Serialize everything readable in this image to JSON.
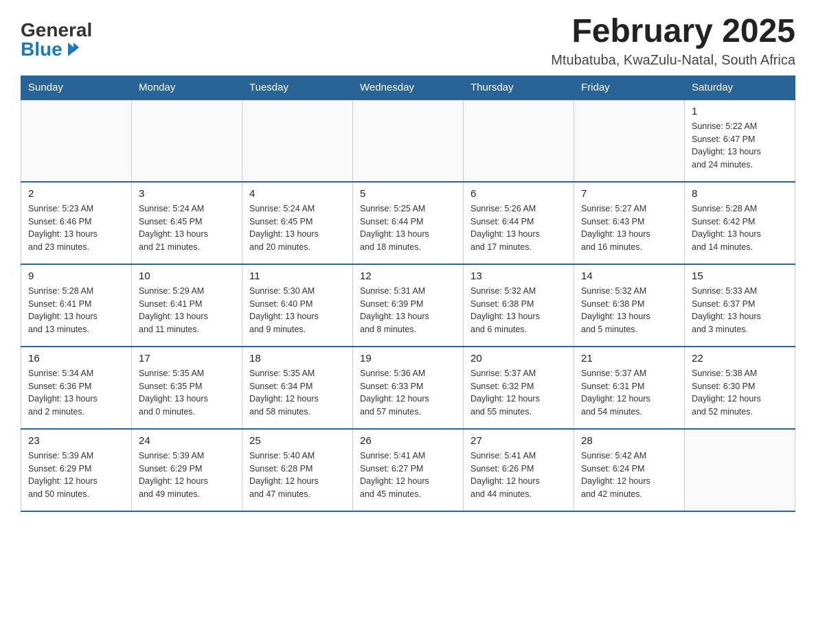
{
  "logo": {
    "general": "General",
    "blue": "Blue"
  },
  "title": "February 2025",
  "location": "Mtubatuba, KwaZulu-Natal, South Africa",
  "weekdays": [
    "Sunday",
    "Monday",
    "Tuesday",
    "Wednesday",
    "Thursday",
    "Friday",
    "Saturday"
  ],
  "weeks": [
    [
      {
        "day": "",
        "info": ""
      },
      {
        "day": "",
        "info": ""
      },
      {
        "day": "",
        "info": ""
      },
      {
        "day": "",
        "info": ""
      },
      {
        "day": "",
        "info": ""
      },
      {
        "day": "",
        "info": ""
      },
      {
        "day": "1",
        "info": "Sunrise: 5:22 AM\nSunset: 6:47 PM\nDaylight: 13 hours\nand 24 minutes."
      }
    ],
    [
      {
        "day": "2",
        "info": "Sunrise: 5:23 AM\nSunset: 6:46 PM\nDaylight: 13 hours\nand 23 minutes."
      },
      {
        "day": "3",
        "info": "Sunrise: 5:24 AM\nSunset: 6:45 PM\nDaylight: 13 hours\nand 21 minutes."
      },
      {
        "day": "4",
        "info": "Sunrise: 5:24 AM\nSunset: 6:45 PM\nDaylight: 13 hours\nand 20 minutes."
      },
      {
        "day": "5",
        "info": "Sunrise: 5:25 AM\nSunset: 6:44 PM\nDaylight: 13 hours\nand 18 minutes."
      },
      {
        "day": "6",
        "info": "Sunrise: 5:26 AM\nSunset: 6:44 PM\nDaylight: 13 hours\nand 17 minutes."
      },
      {
        "day": "7",
        "info": "Sunrise: 5:27 AM\nSunset: 6:43 PM\nDaylight: 13 hours\nand 16 minutes."
      },
      {
        "day": "8",
        "info": "Sunrise: 5:28 AM\nSunset: 6:42 PM\nDaylight: 13 hours\nand 14 minutes."
      }
    ],
    [
      {
        "day": "9",
        "info": "Sunrise: 5:28 AM\nSunset: 6:41 PM\nDaylight: 13 hours\nand 13 minutes."
      },
      {
        "day": "10",
        "info": "Sunrise: 5:29 AM\nSunset: 6:41 PM\nDaylight: 13 hours\nand 11 minutes."
      },
      {
        "day": "11",
        "info": "Sunrise: 5:30 AM\nSunset: 6:40 PM\nDaylight: 13 hours\nand 9 minutes."
      },
      {
        "day": "12",
        "info": "Sunrise: 5:31 AM\nSunset: 6:39 PM\nDaylight: 13 hours\nand 8 minutes."
      },
      {
        "day": "13",
        "info": "Sunrise: 5:32 AM\nSunset: 6:38 PM\nDaylight: 13 hours\nand 6 minutes."
      },
      {
        "day": "14",
        "info": "Sunrise: 5:32 AM\nSunset: 6:38 PM\nDaylight: 13 hours\nand 5 minutes."
      },
      {
        "day": "15",
        "info": "Sunrise: 5:33 AM\nSunset: 6:37 PM\nDaylight: 13 hours\nand 3 minutes."
      }
    ],
    [
      {
        "day": "16",
        "info": "Sunrise: 5:34 AM\nSunset: 6:36 PM\nDaylight: 13 hours\nand 2 minutes."
      },
      {
        "day": "17",
        "info": "Sunrise: 5:35 AM\nSunset: 6:35 PM\nDaylight: 13 hours\nand 0 minutes."
      },
      {
        "day": "18",
        "info": "Sunrise: 5:35 AM\nSunset: 6:34 PM\nDaylight: 12 hours\nand 58 minutes."
      },
      {
        "day": "19",
        "info": "Sunrise: 5:36 AM\nSunset: 6:33 PM\nDaylight: 12 hours\nand 57 minutes."
      },
      {
        "day": "20",
        "info": "Sunrise: 5:37 AM\nSunset: 6:32 PM\nDaylight: 12 hours\nand 55 minutes."
      },
      {
        "day": "21",
        "info": "Sunrise: 5:37 AM\nSunset: 6:31 PM\nDaylight: 12 hours\nand 54 minutes."
      },
      {
        "day": "22",
        "info": "Sunrise: 5:38 AM\nSunset: 6:30 PM\nDaylight: 12 hours\nand 52 minutes."
      }
    ],
    [
      {
        "day": "23",
        "info": "Sunrise: 5:39 AM\nSunset: 6:29 PM\nDaylight: 12 hours\nand 50 minutes."
      },
      {
        "day": "24",
        "info": "Sunrise: 5:39 AM\nSunset: 6:29 PM\nDaylight: 12 hours\nand 49 minutes."
      },
      {
        "day": "25",
        "info": "Sunrise: 5:40 AM\nSunset: 6:28 PM\nDaylight: 12 hours\nand 47 minutes."
      },
      {
        "day": "26",
        "info": "Sunrise: 5:41 AM\nSunset: 6:27 PM\nDaylight: 12 hours\nand 45 minutes."
      },
      {
        "day": "27",
        "info": "Sunrise: 5:41 AM\nSunset: 6:26 PM\nDaylight: 12 hours\nand 44 minutes."
      },
      {
        "day": "28",
        "info": "Sunrise: 5:42 AM\nSunset: 6:24 PM\nDaylight: 12 hours\nand 42 minutes."
      },
      {
        "day": "",
        "info": ""
      }
    ]
  ]
}
